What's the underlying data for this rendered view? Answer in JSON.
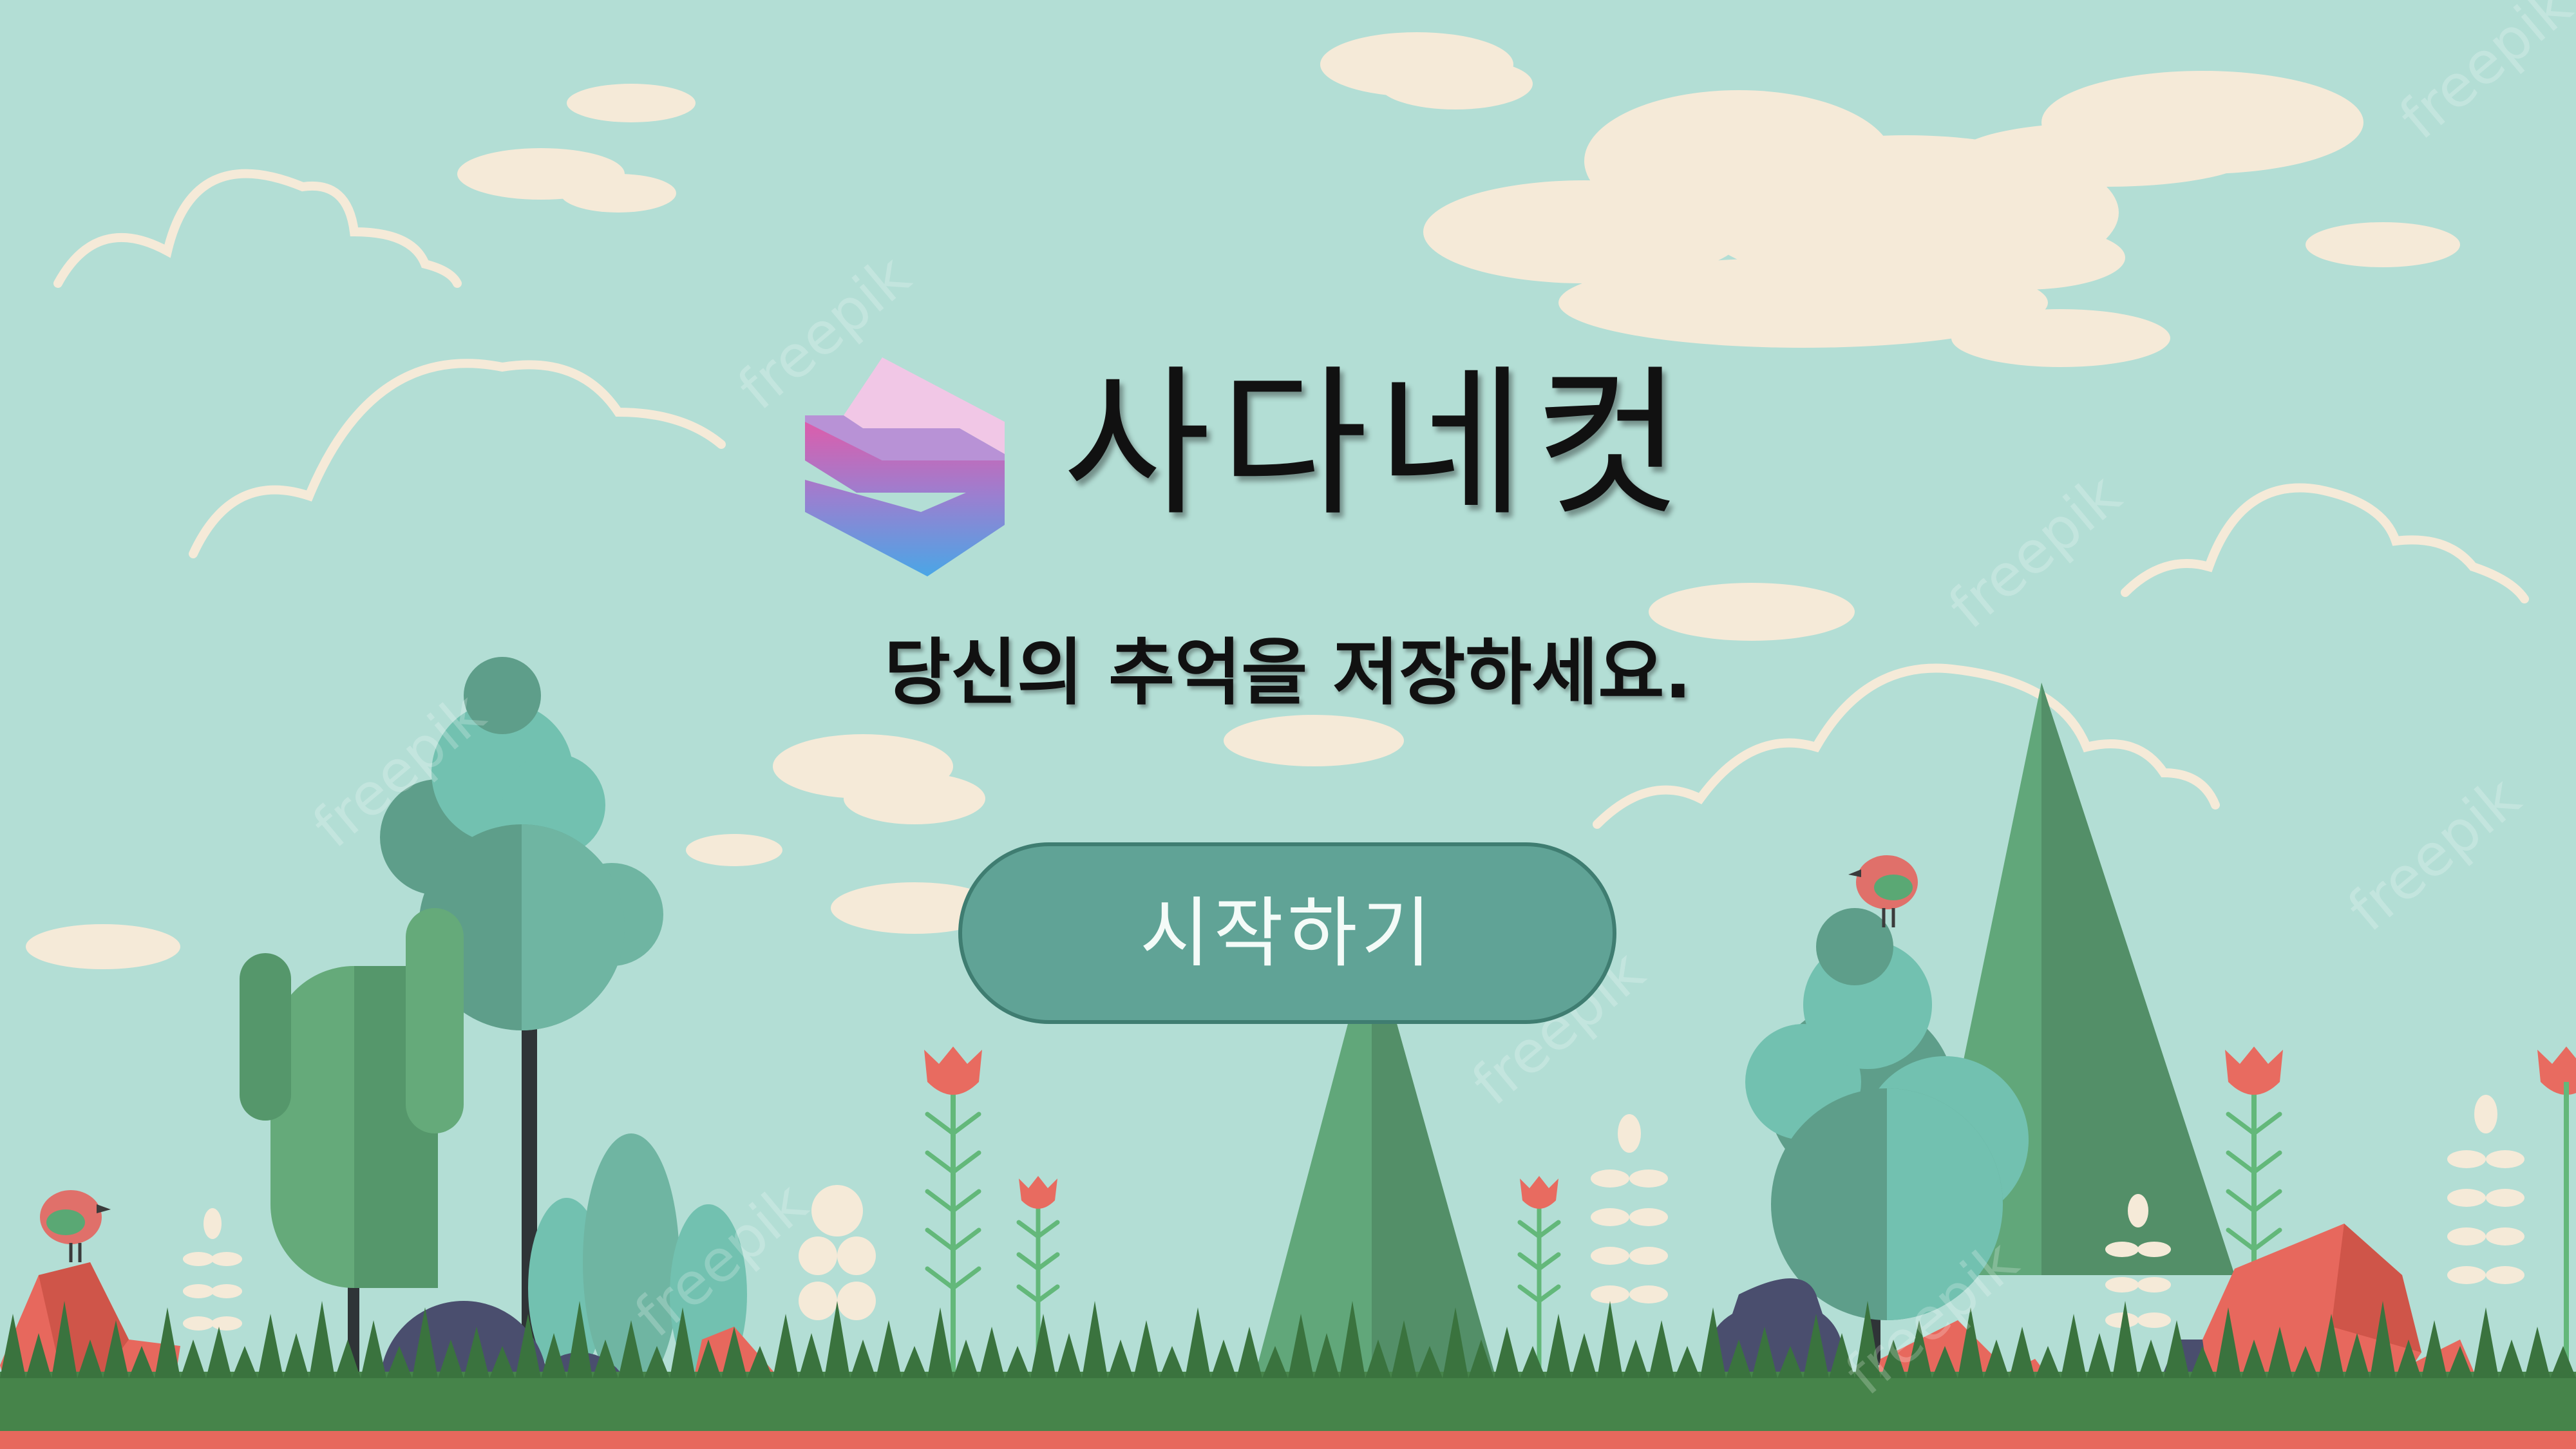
{
  "app": {
    "name": "사다네컷",
    "tagline": "당신의 추억을 저장하세요."
  },
  "actions": {
    "start_label": "시작하기"
  },
  "watermark": {
    "text": "freepik"
  },
  "colors": {
    "sky": "#b3ded5",
    "cloud": "#f5ead8",
    "button": "#60a396",
    "button_border": "#3f7d71",
    "button_text": "#f4fbf8",
    "title_text": "#111111",
    "tree_light": "#72c1b0",
    "tree_dark": "#5e9e8a",
    "pine": "#5c9a72",
    "rock": "#e7685d",
    "bush_dark": "#4a4e6e",
    "grass": "#3f7d3e",
    "ground_stripe": "#e7685d"
  },
  "icons": {
    "logo": "s-logo-icon",
    "bird": "bird-icon",
    "tulip": "tulip-icon"
  }
}
